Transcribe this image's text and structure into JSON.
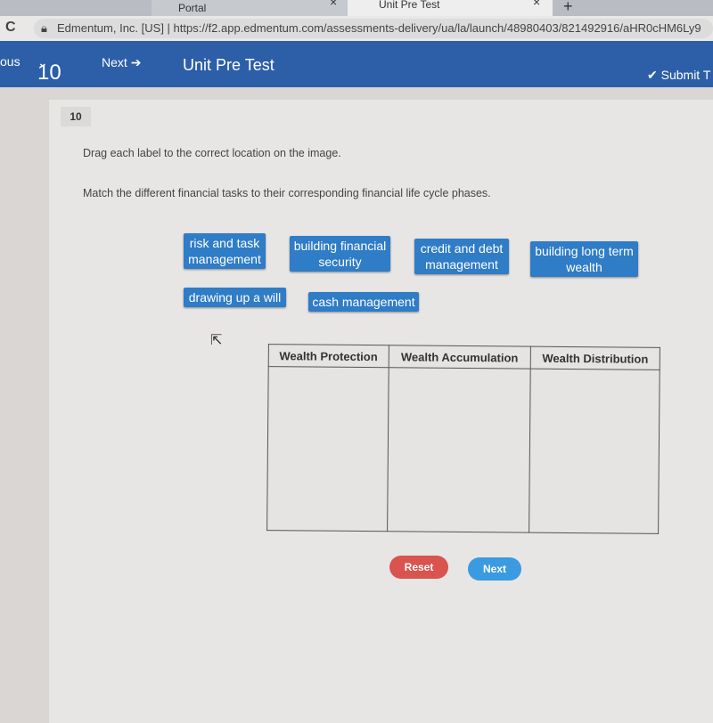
{
  "browser": {
    "tab1_title": "Portal",
    "tab2_title": "Unit Pre Test",
    "site": "Edmentum, Inc. [US]",
    "url": "https://f2.app.edmentum.com/assessments-delivery/ua/la/launch/48980403/821492916/aHR0cHM6Ly9"
  },
  "nav": {
    "previous": "ous",
    "question": "10",
    "next": "Next",
    "title": "Unit Pre Test",
    "submit": "Submit T"
  },
  "question": {
    "number": "10",
    "instruction": "Drag each label to the correct location on the image.",
    "prompt": "Match the different financial tasks to their corresponding financial life cycle phases.",
    "labels": [
      "risk and task management",
      "building financial security",
      "credit and debt management",
      "building long term wealth",
      "drawing up a will",
      "cash management"
    ],
    "columns": [
      "Wealth Protection",
      "Wealth Accumulation",
      "Wealth Distribution"
    ]
  },
  "buttons": {
    "reset": "Reset",
    "next": "Next"
  },
  "colors": {
    "nav": "#2d5fa8",
    "label": "#2f7cc7",
    "reset": "#d9534f",
    "next": "#3a9be0"
  }
}
